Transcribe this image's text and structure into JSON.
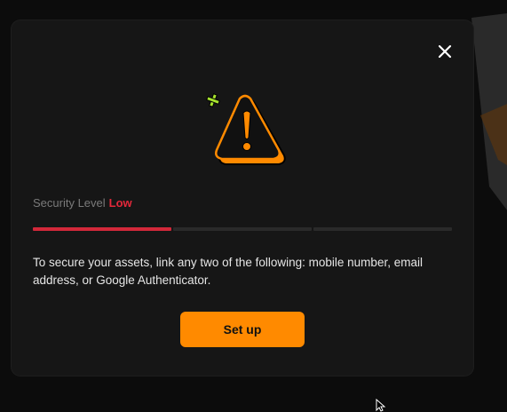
{
  "modal": {
    "close_icon": "close-icon",
    "illustration_icon": "warning-triangle-icon",
    "security_label": "Security Level",
    "security_value": "Low",
    "security_progress": 0.33,
    "description": "To secure your assets, link any two of the following: mobile number, email address, or Google Authenticator.",
    "setup_label": "Set up"
  },
  "colors": {
    "accent": "#ff8a00",
    "danger": "#d3283a",
    "modal_bg": "#161616",
    "spark": "#a6e22e"
  }
}
